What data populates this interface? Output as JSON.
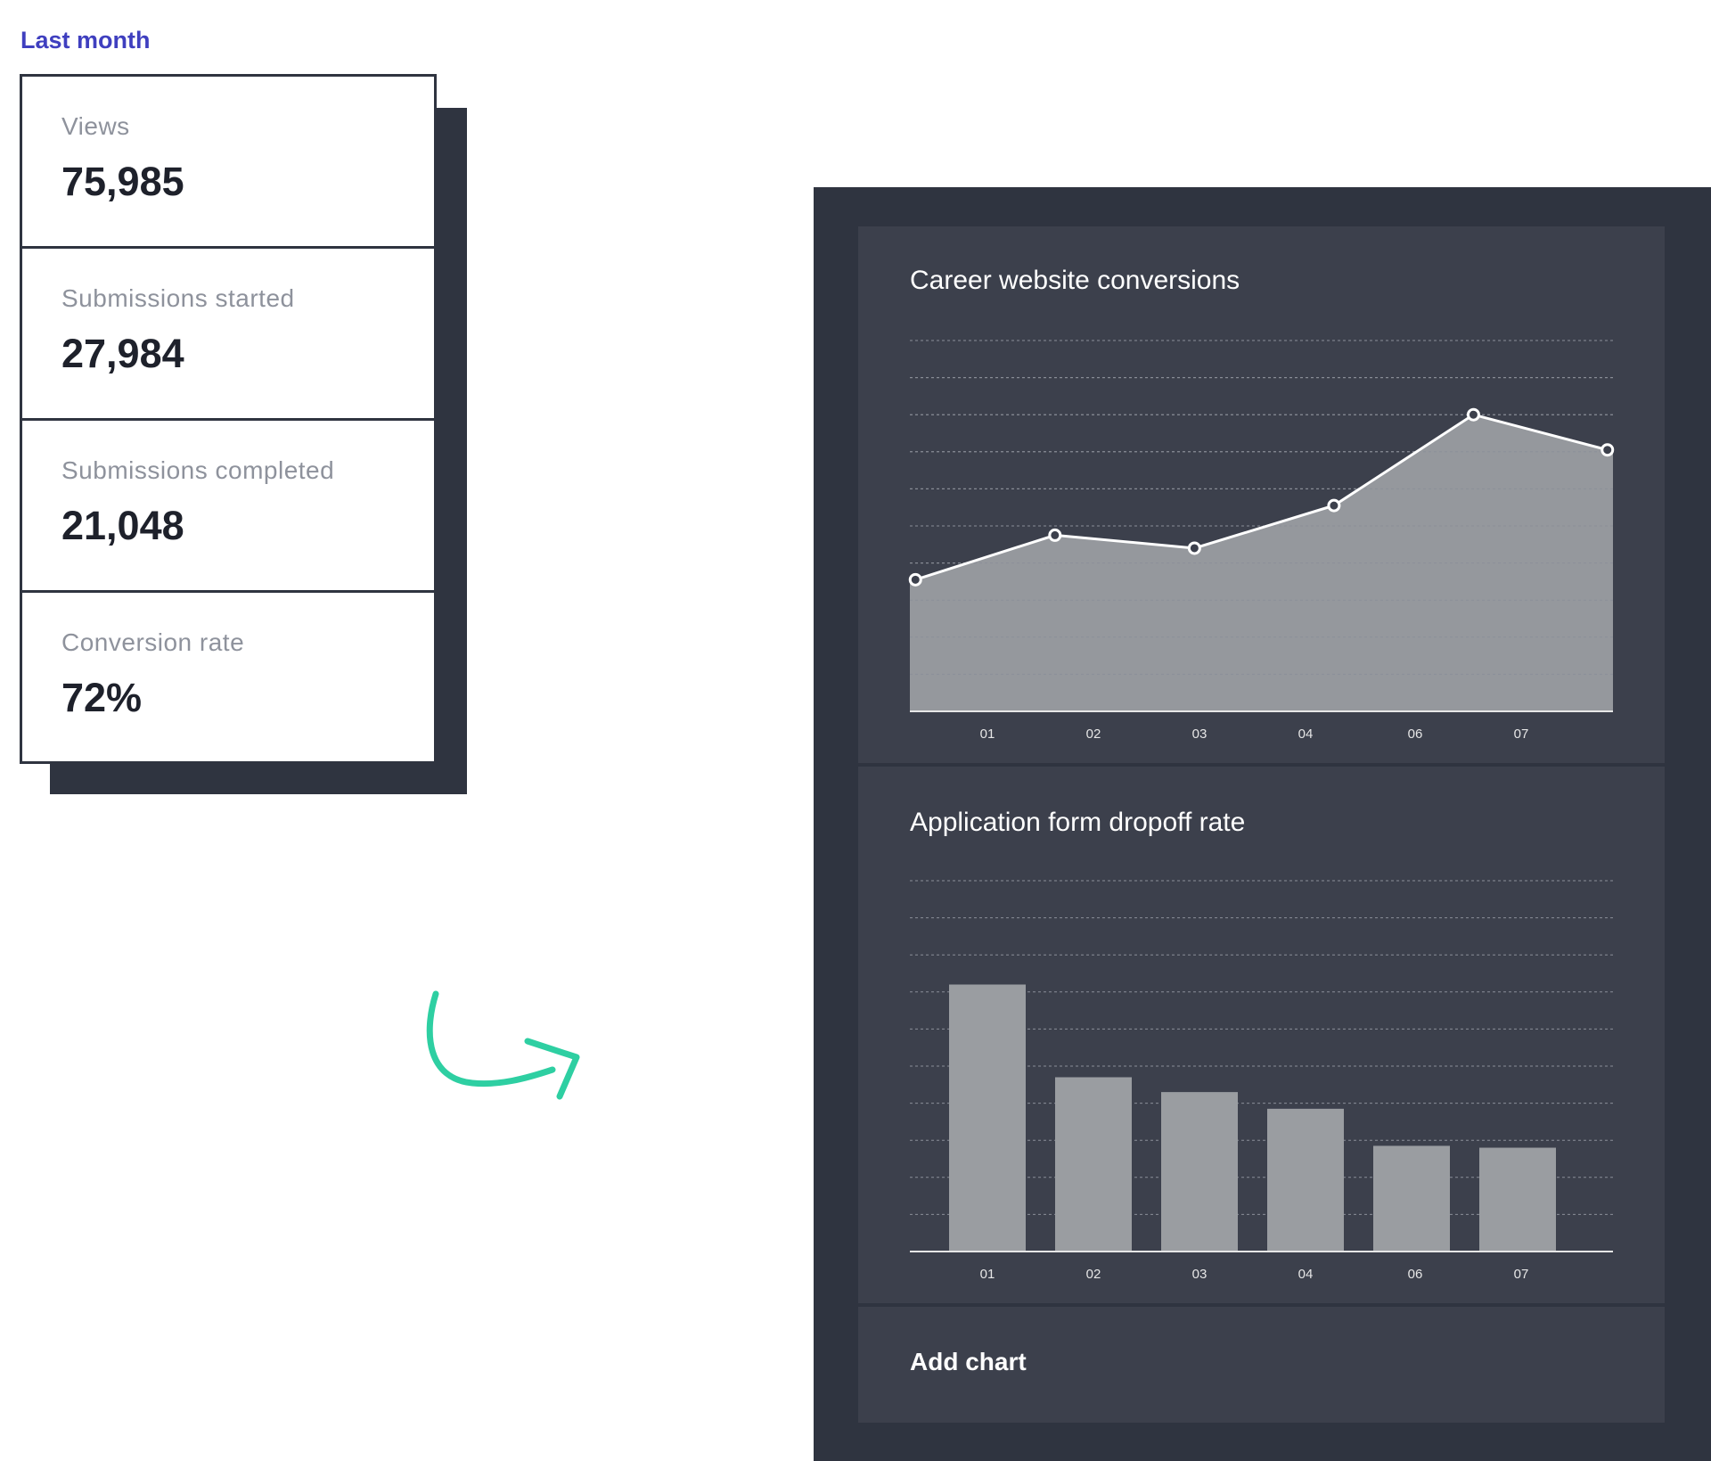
{
  "period": {
    "label": "Last month"
  },
  "stats": [
    {
      "label": "Views",
      "value": "75,985"
    },
    {
      "label": "Submissions started",
      "value": "27,984"
    },
    {
      "label": "Submissions completed",
      "value": "21,048"
    },
    {
      "label": "Conversion rate",
      "value": "72%"
    }
  ],
  "add_chart_label": "Add chart",
  "colors": {
    "accent": "#3f3fbf",
    "arrow": "#2ecfa2",
    "panel_bg": "#2f3440",
    "card_bg": "#3c404c",
    "area_fill": "#9a9da1"
  },
  "icons": {
    "arrow": "curved-arrow-icon"
  },
  "chart_data": [
    {
      "type": "area",
      "title": "Career website conversions",
      "categories": [
        "01",
        "02",
        "03",
        "04",
        "06",
        "07"
      ],
      "x": [
        0.05,
        1.3,
        2.55,
        3.8,
        5.05,
        6.25
      ],
      "values": [
        35.5,
        47.5,
        44,
        55.5,
        80,
        70.5
      ],
      "ylim": [
        0,
        100
      ],
      "grid": true,
      "markers": true
    },
    {
      "type": "bar",
      "title": "Application form dropoff rate",
      "categories": [
        "01",
        "02",
        "03",
        "04",
        "06",
        "07"
      ],
      "values": [
        72,
        47,
        43,
        38.5,
        28.5,
        28
      ],
      "ylim": [
        0,
        100
      ],
      "grid": true
    }
  ]
}
